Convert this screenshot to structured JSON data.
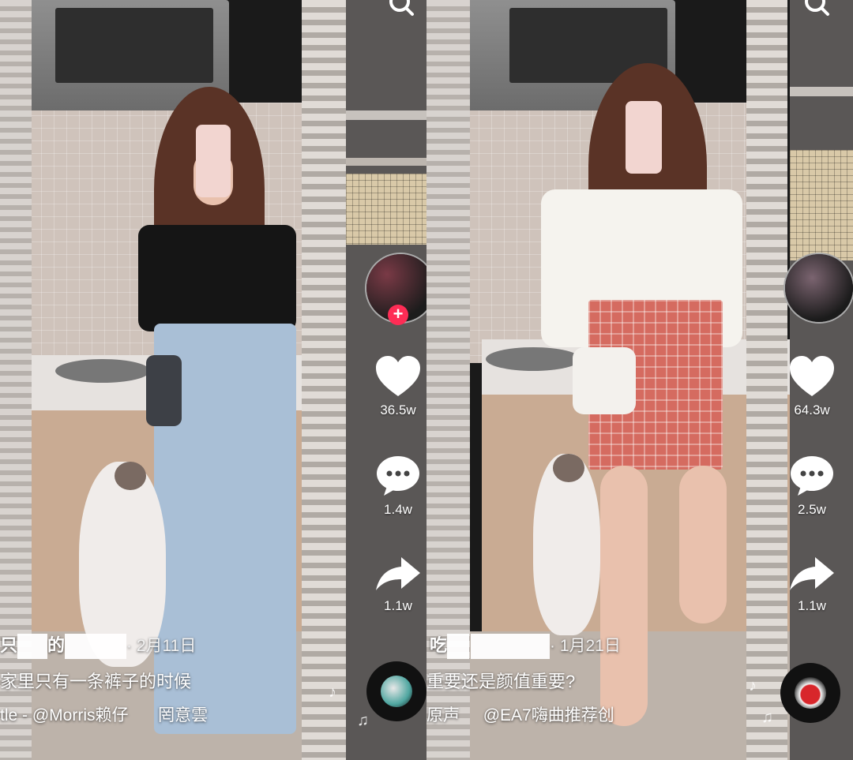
{
  "panels": [
    {
      "likes": "36.5w",
      "comments": "1.4w",
      "shares": "1.1w",
      "username_prefix": "只",
      "username_mid": "的",
      "date": "· 2月11日",
      "description": "家里只有一条裤子的时候",
      "music": "tle - @Morris赖仔",
      "music_extra": "罔意雲"
    },
    {
      "likes": "64.3w",
      "comments": "2.5w",
      "shares": "1.1w",
      "username_prefix": "吃",
      "date": "· 1月21日",
      "description": "重要还是颜值重要?",
      "music": "原声",
      "music_extra": "@EA7嗨曲推荐创"
    }
  ],
  "colors": {
    "follow_accent": "#fe2c55",
    "overlay_text": "#ffffff"
  },
  "icons": [
    "search-icon",
    "heart-icon",
    "comment-icon",
    "share-icon",
    "music-note-icon",
    "music-disc-icon"
  ]
}
